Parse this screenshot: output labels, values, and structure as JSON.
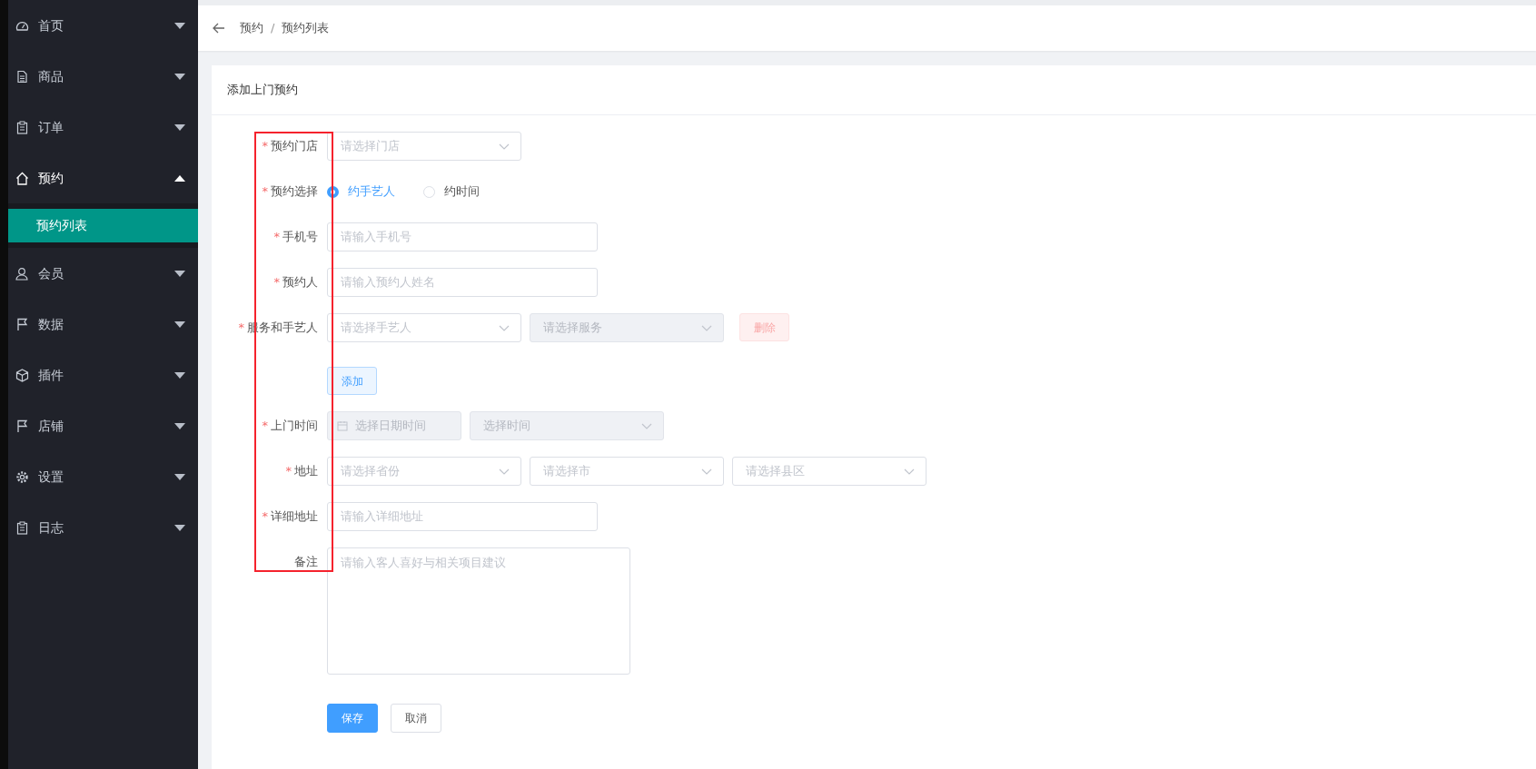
{
  "sidebar": {
    "items": [
      {
        "label": "首页",
        "expanded": false
      },
      {
        "label": "商品",
        "expanded": false
      },
      {
        "label": "订单",
        "expanded": false
      },
      {
        "label": "预约",
        "expanded": true,
        "children": [
          {
            "label": "预约列表",
            "selected": true
          }
        ]
      },
      {
        "label": "会员",
        "expanded": false
      },
      {
        "label": "数据",
        "expanded": false
      },
      {
        "label": "插件",
        "expanded": false
      },
      {
        "label": "店铺",
        "expanded": false
      },
      {
        "label": "设置",
        "expanded": false
      },
      {
        "label": "日志",
        "expanded": false
      }
    ]
  },
  "breadcrumb": {
    "items": [
      "预约",
      "预约列表"
    ],
    "separator": "/"
  },
  "card": {
    "title": "添加上门预约"
  },
  "form": {
    "rows": [
      {
        "kind": "select",
        "label": "预约门店",
        "required_mark": "*",
        "fields": [
          {
            "kind": "select",
            "placeholder": "请选择门店",
            "disabled": false
          }
        ]
      },
      {
        "kind": "radio",
        "label": "预约选择",
        "required_mark": "*",
        "options": [
          {
            "label": "约手艺人",
            "selected": true
          },
          {
            "label": "约时间",
            "selected": false
          }
        ]
      },
      {
        "kind": "input",
        "label": "手机号",
        "required_mark": "*",
        "fields": [
          {
            "kind": "input",
            "placeholder": "请输入手机号",
            "disabled": false
          }
        ]
      },
      {
        "kind": "input",
        "label": "预约人",
        "required_mark": "*",
        "fields": [
          {
            "kind": "input",
            "placeholder": "请输入预约人姓名",
            "disabled": false
          }
        ]
      },
      {
        "kind": "service",
        "label": "服务和手艺人",
        "required_mark": "*",
        "fields": [
          {
            "kind": "select",
            "placeholder": "请选择手艺人",
            "disabled": false
          },
          {
            "kind": "select",
            "placeholder": "请选择服务",
            "disabled": true
          }
        ],
        "delete_button": {
          "label": "删除",
          "disabled": true
        },
        "add_button": "添加"
      },
      {
        "kind": "select",
        "label": "上门时间",
        "required_mark": "*",
        "fields": [
          {
            "kind": "date",
            "placeholder": "选择日期时间",
            "disabled": true
          },
          {
            "kind": "select",
            "placeholder": "选择时间",
            "disabled": true
          }
        ]
      },
      {
        "kind": "select",
        "label": "地址",
        "required_mark": "*",
        "fields": [
          {
            "kind": "select",
            "placeholder": "请选择省份",
            "disabled": false
          },
          {
            "kind": "select",
            "placeholder": "请选择市",
            "disabled": false
          },
          {
            "kind": "select",
            "placeholder": "请选择县区",
            "disabled": false
          }
        ]
      },
      {
        "kind": "input",
        "label": "详细地址",
        "required_mark": "*",
        "fields": [
          {
            "kind": "input",
            "placeholder": "请输入详细地址",
            "disabled": false
          }
        ]
      },
      {
        "kind": "textarea",
        "label": "备注",
        "fields": [
          {
            "kind": "textarea",
            "placeholder": "请输入客人喜好与相关项目建议",
            "disabled": false
          }
        ]
      }
    ],
    "actions": [
      {
        "label": "保存",
        "kind": "primary"
      },
      {
        "label": "取消",
        "kind": "default"
      }
    ]
  },
  "annotation": {
    "kind": "highlight-box"
  }
}
